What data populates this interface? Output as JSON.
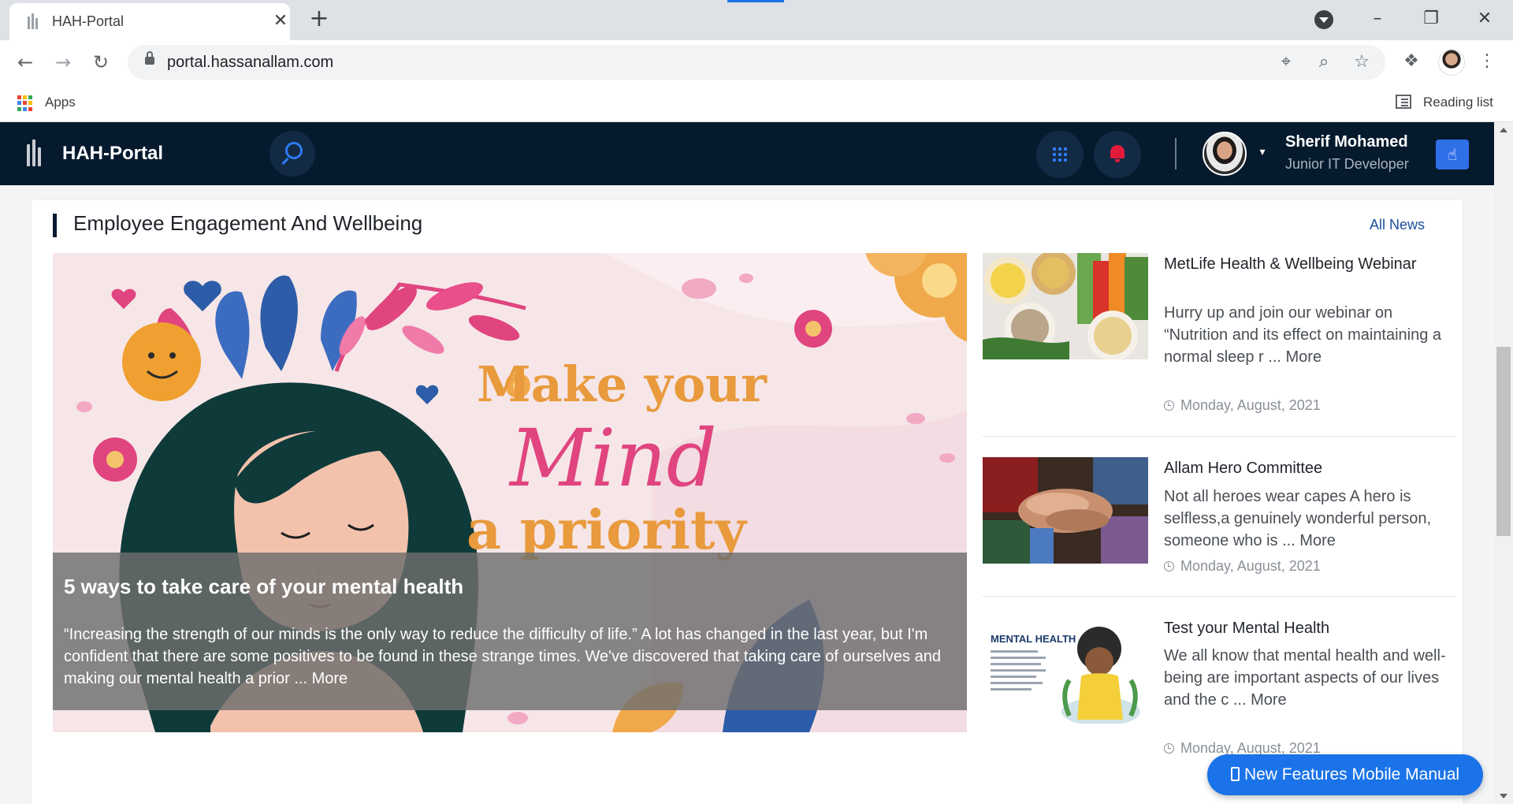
{
  "browser": {
    "tab_title": "HAH-Portal",
    "tab_close": "✕",
    "new_tab": "+",
    "url": "portal.hassanallam.com",
    "bookmarks_apps": "Apps",
    "reading_list": "Reading list"
  },
  "appbar": {
    "title": "HAH-Portal",
    "user_name": "Sherif Mohamed",
    "user_role": "Junior IT Developer"
  },
  "section": {
    "title": "Employee Engagement And Wellbeing",
    "all_news": "All News"
  },
  "feature": {
    "image_text_line1": "Make your",
    "image_text_line2": "Mind",
    "image_text_line3": "a priority",
    "title": "5 ways to take care of your mental health",
    "body": "“Increasing the strength of our minds is the only way to reduce the difficulty of life.” A lot has changed in the last year, but I'm confident that there are some positives to be found in these strange times. We've discovered that taking care of ourselves and making our mental health a prior ... More"
  },
  "news": [
    {
      "title": "MetLife Health & Wellbeing Webinar",
      "body": "Hurry up and join our webinar on “Nutrition and its effect on maintaining a normal sleep r ... More",
      "date": "Monday, August, 2021"
    },
    {
      "title": "Allam Hero Committee",
      "body": "Not all heroes wear capes A hero is selfless,a genuinely wonderful person, someone who is ... More",
      "date": "Monday, August, 2021"
    },
    {
      "title": "Test your Mental Health",
      "body": "We all know that mental health and well-being are important aspects of our lives and the c ... More",
      "date": "Monday, August, 2021",
      "thumb_text": "MENTAL HEALTH"
    }
  ],
  "fab_label": "New Features Mobile Manual",
  "colors": {
    "appbar": "#061a2e",
    "accent": "#2f6fe8",
    "link": "#1b4f9c",
    "bell": "#e31b3b",
    "headline_orange": "#e89a3c",
    "headline_pink": "#e0457f"
  }
}
